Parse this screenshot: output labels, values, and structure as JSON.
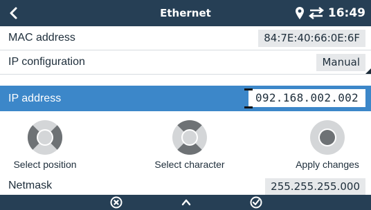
{
  "header": {
    "title": "Ethernet",
    "clock": "16:49",
    "icons": [
      "back-chevron-icon",
      "location-pin-icon",
      "transfer-arrows-icon"
    ]
  },
  "rows": {
    "mac": {
      "label": "MAC address",
      "value": "84:7E:40:66:0E:6F"
    },
    "ipconfig": {
      "label": "IP configuration",
      "value": "Manual"
    },
    "ipaddress": {
      "label": "IP address",
      "value": "092.168.002.002"
    },
    "netmask": {
      "label": "Netmask",
      "value": "255.255.255.000"
    }
  },
  "help": {
    "select_position": "Select position",
    "select_character": "Select character",
    "apply_changes": "Apply changes"
  },
  "footer": {
    "icons": [
      "cancel-icon",
      "up-chevron-icon",
      "confirm-check-icon"
    ]
  },
  "colors": {
    "header_bg": "#263f55",
    "selected_row": "#3c87c9",
    "value_box": "#e6e8ea",
    "dpad_gray": "#6e7275"
  }
}
